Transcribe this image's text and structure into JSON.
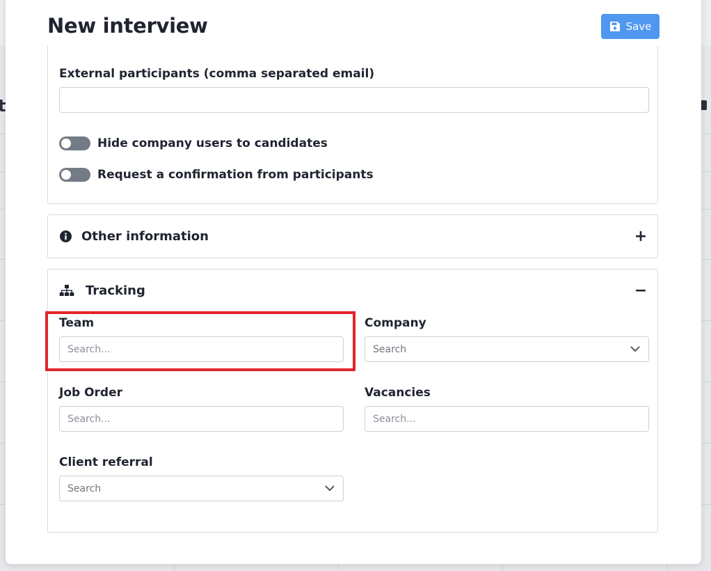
{
  "modal": {
    "title": "New interview",
    "save_label": "Save"
  },
  "participants": {
    "external_label": "External participants (comma separated email)",
    "external_value": "",
    "external_placeholder": "",
    "toggles": [
      {
        "label": "Hide company users to candidates",
        "on": false
      },
      {
        "label": "Request a confirmation from participants",
        "on": false
      }
    ]
  },
  "other_information": {
    "title": "Other information",
    "expand_symbol": "+"
  },
  "tracking": {
    "title": "Tracking",
    "collapse_symbol": "−",
    "team": {
      "label": "Team",
      "placeholder": "Search..."
    },
    "company": {
      "label": "Company",
      "selected": "Search"
    },
    "job_order": {
      "label": "Job Order",
      "placeholder": "Search..."
    },
    "vacancies": {
      "label": "Vacancies",
      "placeholder": "Search..."
    },
    "client_referral": {
      "label": "Client referral",
      "selected": "Search"
    }
  },
  "colors": {
    "save_button": "#4f97f0",
    "toggle_off": "#737b86",
    "highlight": "#e0252b"
  },
  "background_page": {
    "edge_text": "t"
  }
}
